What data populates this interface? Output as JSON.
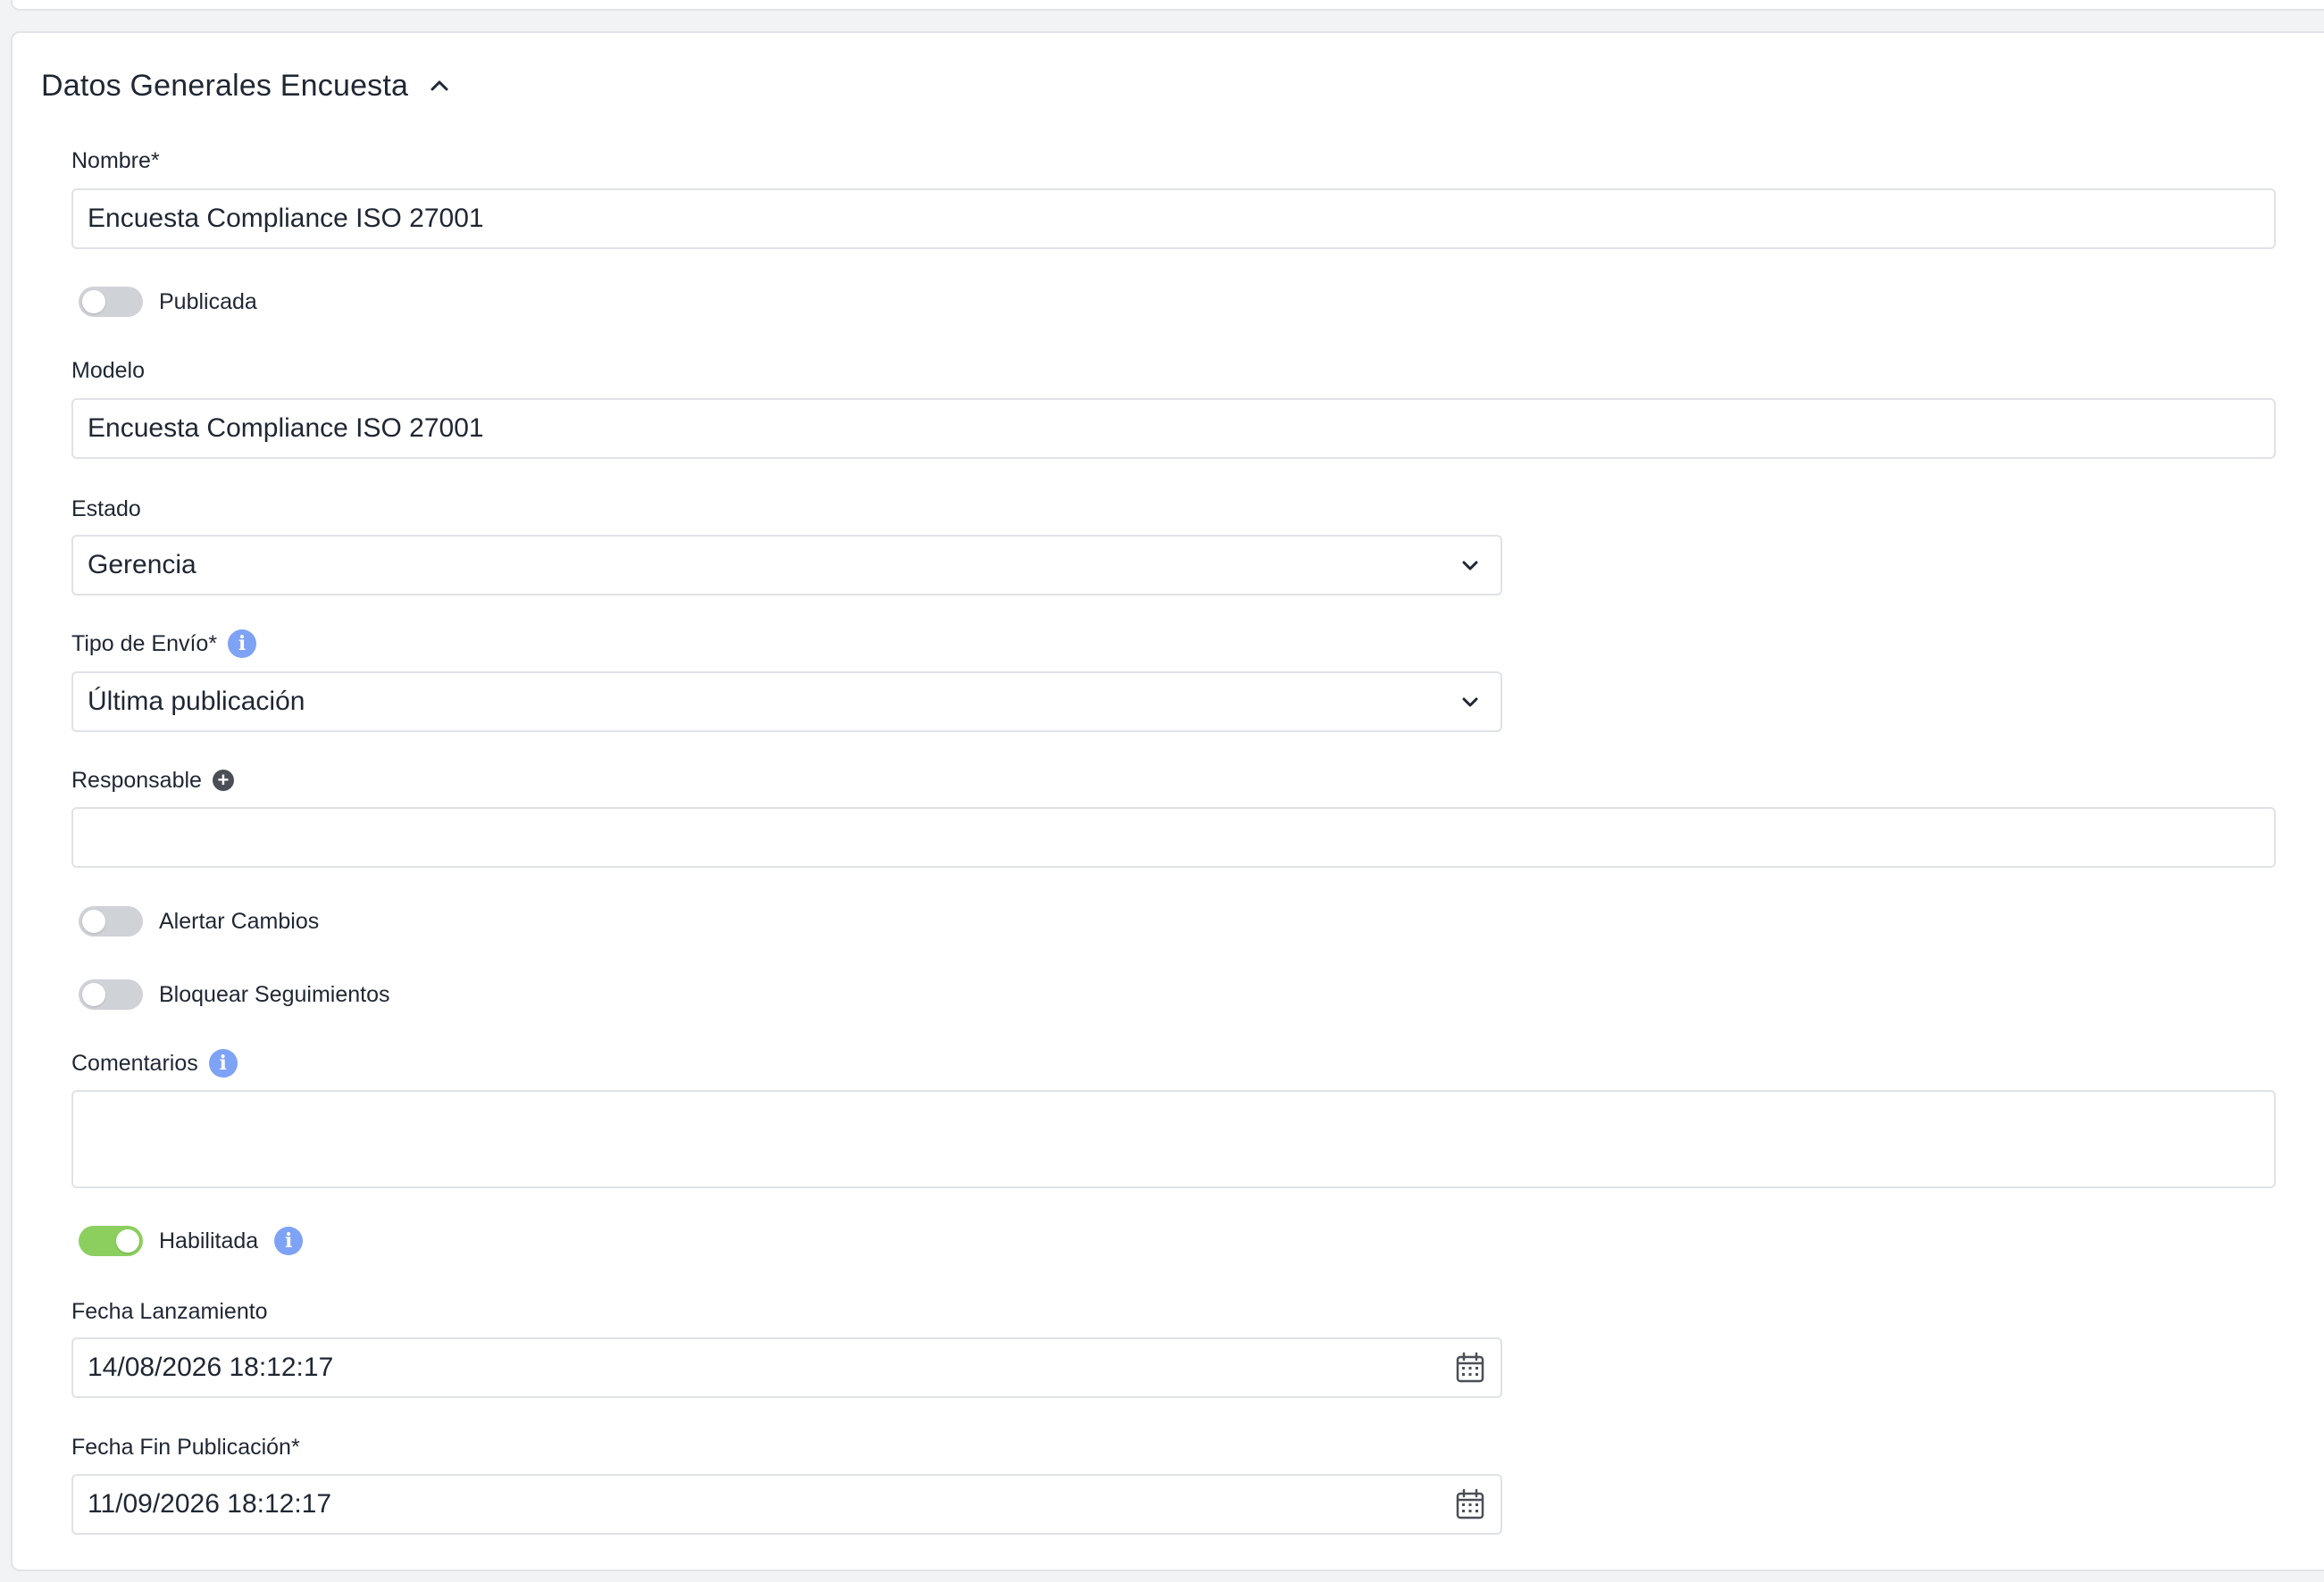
{
  "section": {
    "title": "Datos Generales Encuesta"
  },
  "form": {
    "nombre": {
      "label": "Nombre*",
      "value": "Encuesta Compliance ISO 27001"
    },
    "publicada": {
      "label": "Publicada",
      "checked": false
    },
    "modelo": {
      "label": "Modelo",
      "value": "Encuesta Compliance ISO 27001"
    },
    "estado": {
      "label": "Estado",
      "selected": "Gerencia"
    },
    "tipo_envio": {
      "label": "Tipo de Envío*",
      "selected": "Última publicación"
    },
    "responsable": {
      "label": "Responsable",
      "value": ""
    },
    "alertar_cambios": {
      "label": "Alertar Cambios",
      "checked": false
    },
    "bloquear_seguimientos": {
      "label": "Bloquear Seguimientos",
      "checked": false
    },
    "comentarios": {
      "label": "Comentarios",
      "value": ""
    },
    "habilitada": {
      "label": "Habilitada",
      "checked": true
    },
    "fecha_lanzamiento": {
      "label": "Fecha Lanzamiento",
      "value": "14/08/2026 18:12:17"
    },
    "fecha_fin_publicacion": {
      "label": "Fecha Fin Publicación*",
      "value": "11/09/2026 18:12:17"
    }
  },
  "icons": {
    "section_toggle": "chevron-up-icon",
    "select_arrow": "chevron-down-icon",
    "info": "info-icon",
    "add": "plus-circle-icon",
    "date": "calendar-icon"
  },
  "colors": {
    "toggle_off": "#cfd2d6",
    "toggle_on": "#8ccf5e",
    "info_icon": "#7ea2f5",
    "field_border": "#dfe2e6",
    "text": "#1f2733"
  }
}
